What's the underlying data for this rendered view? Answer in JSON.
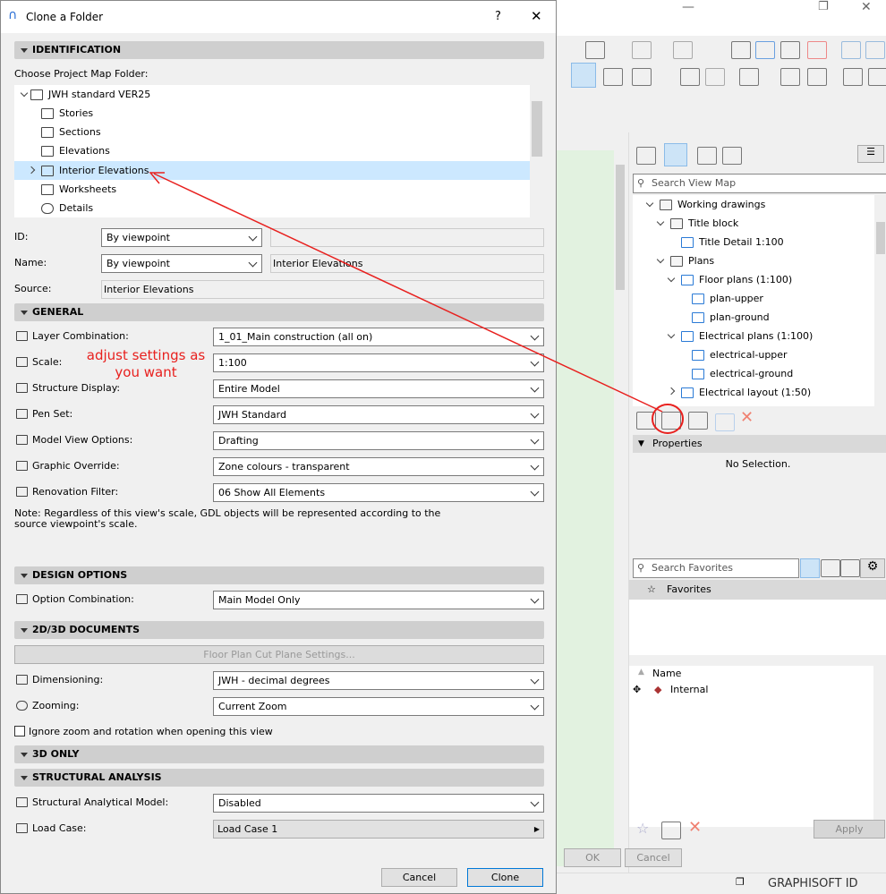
{
  "window_controls": {
    "minimize": "—",
    "restore": "❐",
    "close": "✕"
  },
  "dialog": {
    "title": "Clone a Folder",
    "help": "?",
    "close": "✕",
    "identification": {
      "header": "IDENTIFICATION",
      "choose_label": "Choose Project Map Folder:",
      "tree": [
        {
          "label": "JWH standard VER25",
          "icon": "project-icon",
          "expanded": true
        },
        {
          "label": "Stories",
          "icon": "stories-icon"
        },
        {
          "label": "Sections",
          "icon": "sections-icon"
        },
        {
          "label": "Elevations",
          "icon": "elevations-icon"
        },
        {
          "label": "Interior Elevations",
          "icon": "interior-elevations-icon",
          "selected": true
        },
        {
          "label": "Worksheets",
          "icon": "worksheets-icon"
        },
        {
          "label": "Details",
          "icon": "details-icon"
        }
      ],
      "id_label": "ID:",
      "id_value": "By viewpoint",
      "id_text": "",
      "name_label": "Name:",
      "name_value": "By viewpoint",
      "name_text": "Interior Elevations",
      "source_label": "Source:",
      "source_value": "Interior Elevations"
    },
    "general": {
      "header": "GENERAL",
      "rows": [
        {
          "label": "Layer Combination:",
          "value": "1_01_Main construction (all on)",
          "icon": "layers-icon"
        },
        {
          "label": "Scale:",
          "value": "1:100",
          "icon": "scale-icon"
        },
        {
          "label": "Structure Display:",
          "value": "Entire Model",
          "icon": "structure-icon"
        },
        {
          "label": "Pen Set:",
          "value": "JWH Standard",
          "icon": "pen-icon"
        },
        {
          "label": "Model View Options:",
          "value": "Drafting",
          "icon": "model-view-icon"
        },
        {
          "label": "Graphic Override:",
          "value": "Zone colours - transparent",
          "icon": "graphic-override-icon"
        },
        {
          "label": "Renovation Filter:",
          "value": "06 Show All Elements",
          "icon": "renovation-icon"
        }
      ],
      "note": "Note: Regardless of this view's scale, GDL objects will be represented according to the source viewpoint's scale."
    },
    "design_options": {
      "header": "DESIGN OPTIONS",
      "label": "Option Combination:",
      "value": "Main Model Only"
    },
    "docs": {
      "header": "2D/3D DOCUMENTS",
      "cut_plane_button": "Floor Plan Cut Plane Settings...",
      "dimensioning_label": "Dimensioning:",
      "dimensioning_value": "JWH - decimal degrees",
      "zooming_label": "Zooming:",
      "zooming_value": "Current Zoom",
      "ignore_zoom_label": "Ignore zoom and rotation when opening this view",
      "ignore_zoom_checked": false
    },
    "only3d": {
      "header": "3D ONLY"
    },
    "structural": {
      "header": "STRUCTURAL ANALYSIS",
      "model_label": "Structural Analytical Model:",
      "model_value": "Disabled",
      "load_label": "Load Case:",
      "load_value": "Load Case 1"
    },
    "cancel": "Cancel",
    "clone": "Clone"
  },
  "annotation": {
    "text_line1": "adjust settings as",
    "text_line2": "you want",
    "color": "#e8201e"
  },
  "navigator": {
    "search_placeholder": "Search View Map",
    "tree": [
      {
        "label": "Working drawings",
        "type": "folder",
        "level": 0
      },
      {
        "label": "Title block",
        "type": "folder",
        "level": 1
      },
      {
        "label": "Title Detail 1:100",
        "type": "view",
        "level": 2
      },
      {
        "label": "Plans",
        "type": "folder",
        "level": 1
      },
      {
        "label": "Floor plans (1:100)",
        "type": "clone",
        "level": 2
      },
      {
        "label": "plan-upper",
        "type": "view",
        "level": 3
      },
      {
        "label": "plan-ground",
        "type": "view",
        "level": 3
      },
      {
        "label": "Electrical plans (1:100)",
        "type": "clone",
        "level": 2
      },
      {
        "label": "electrical-upper",
        "type": "view",
        "level": 3
      },
      {
        "label": "electrical-ground",
        "type": "view",
        "level": 3
      },
      {
        "label": "Electrical layout (1:50)",
        "type": "clone",
        "level": 2
      }
    ],
    "properties_header": "Properties",
    "no_selection": "No Selection.",
    "favorites_placeholder": "Search Favorites",
    "favorites_label": "Favorites",
    "name_col": "Name",
    "internal": "Internal",
    "apply": "Apply",
    "ok": "OK",
    "cancel": "Cancel",
    "graphisoft_id": "GRAPHISOFT ID"
  }
}
